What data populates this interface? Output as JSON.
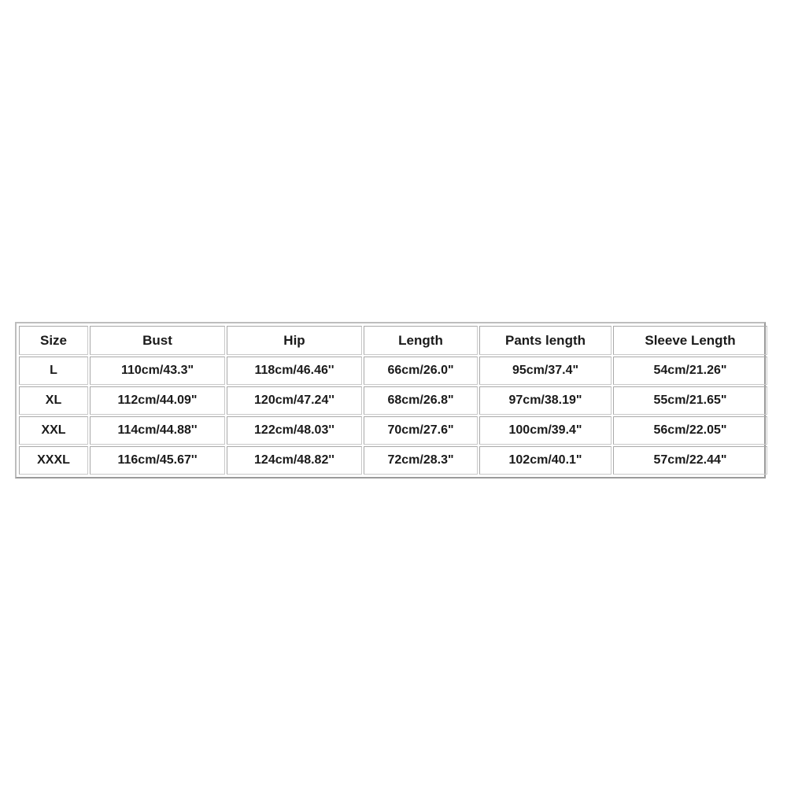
{
  "size_chart": {
    "headers": [
      "Size",
      "Bust",
      "Hip",
      "Length",
      "Pants length",
      "Sleeve Length"
    ],
    "rows": [
      [
        "L",
        "110cm/43.3\"",
        "118cm/46.46''",
        "66cm/26.0\"",
        "95cm/37.4\"",
        "54cm/21.26\""
      ],
      [
        "XL",
        "112cm/44.09\"",
        "120cm/47.24''",
        "68cm/26.8\"",
        "97cm/38.19\"",
        "55cm/21.65\""
      ],
      [
        "XXL",
        "114cm/44.88''",
        "122cm/48.03''",
        "70cm/27.6\"",
        "100cm/39.4\"",
        "56cm/22.05\""
      ],
      [
        "XXXL",
        "116cm/45.67''",
        "124cm/48.82''",
        "72cm/28.3\"",
        "102cm/40.1\"",
        "57cm/22.44\""
      ]
    ]
  }
}
